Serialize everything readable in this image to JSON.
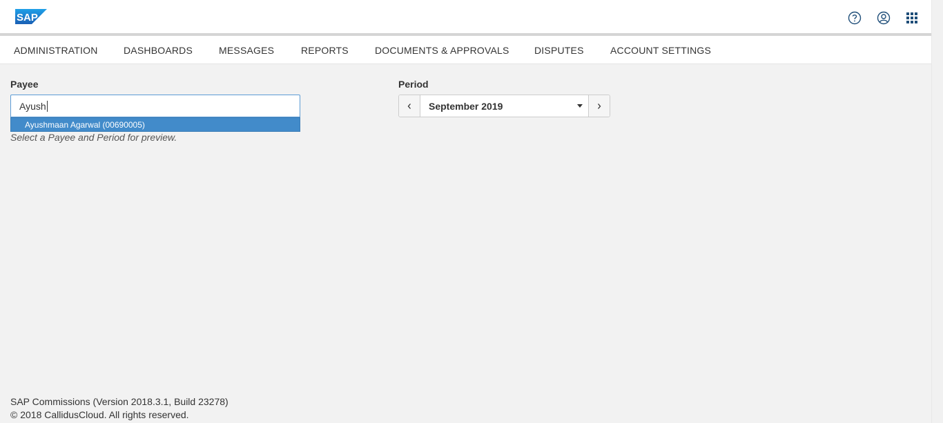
{
  "brand": {
    "logo_text": "SAP",
    "logo_color": "#1a73c8"
  },
  "header": {
    "icons": [
      "help-icon",
      "user-account-icon",
      "app-grid-icon"
    ]
  },
  "nav": {
    "items": [
      {
        "label": "ADMINISTRATION"
      },
      {
        "label": "DASHBOARDS"
      },
      {
        "label": "MESSAGES"
      },
      {
        "label": "REPORTS"
      },
      {
        "label": "DOCUMENTS & APPROVALS"
      },
      {
        "label": "DISPUTES"
      },
      {
        "label": "ACCOUNT SETTINGS"
      }
    ]
  },
  "payee": {
    "label": "Payee",
    "value": "Ayush",
    "suggestions": [
      {
        "label": "Ayushmaan Agarwal (00690005)"
      }
    ],
    "hint": "Select a Payee and Period for preview."
  },
  "period": {
    "label": "Period",
    "value": "September 2019"
  },
  "footer": {
    "version": "SAP Commissions (Version 2018.3.1, Build 23278)",
    "copyright": "© 2018 CallidusCloud. All rights reserved."
  },
  "colors": {
    "accent": "#428bca",
    "input_focus_border": "#5b9bd5",
    "background": "#f2f2f2"
  }
}
